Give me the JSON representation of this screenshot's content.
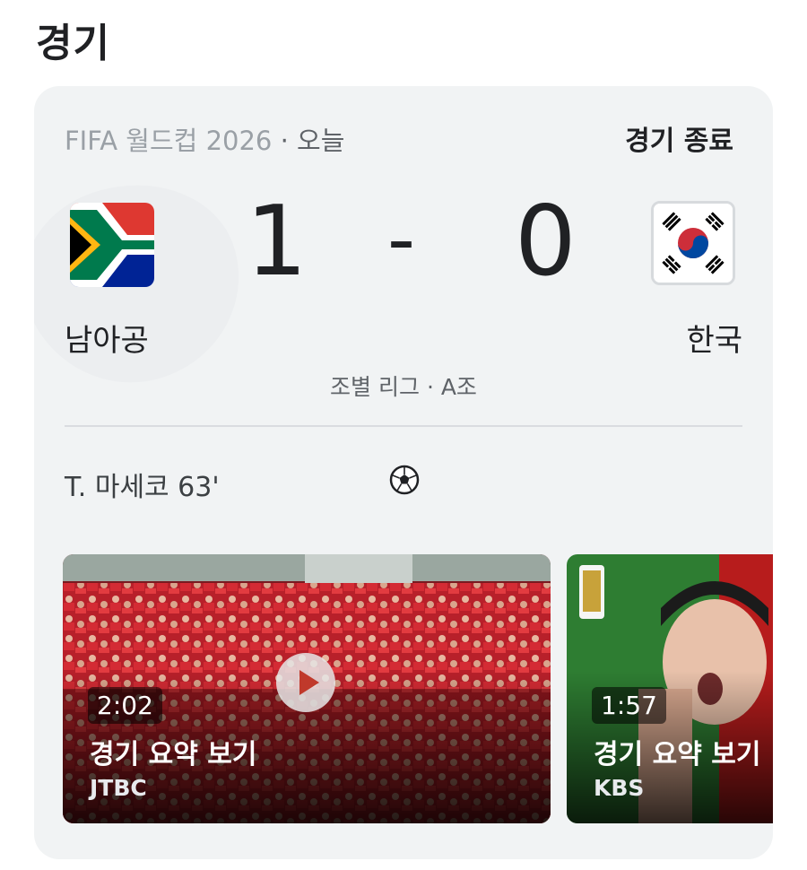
{
  "section": {
    "title": "경기"
  },
  "match": {
    "competition": "FIFA 월드컵 2026",
    "separator": " · ",
    "date": "오늘",
    "status": "경기 종료",
    "home": {
      "name": "남아공",
      "score": "1",
      "flag_icon": "south-africa-flag-icon"
    },
    "away": {
      "name": "한국",
      "score": "0",
      "flag_icon": "korea-flag-icon"
    },
    "score_separator": "-",
    "round": "조별 리그 · A조",
    "goals": [
      {
        "text": "T. 마세코 63'",
        "icon": "soccer-ball-icon"
      }
    ]
  },
  "videos": [
    {
      "duration": "2:02",
      "title": "경기 요약 보기",
      "source": "JTBC"
    },
    {
      "duration": "1:57",
      "title": "경기 요약 보기",
      "source": "KBS"
    }
  ],
  "colors": {
    "card_bg": "#f1f3f4",
    "text": "#202124",
    "muted": "#5f6368"
  }
}
